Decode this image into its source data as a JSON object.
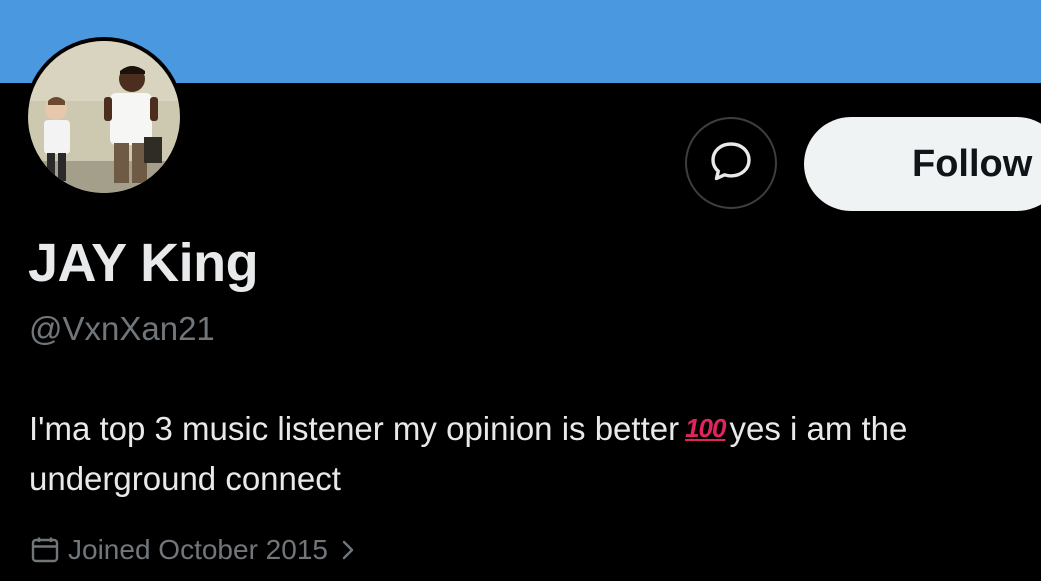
{
  "profile": {
    "display_name": "JAY King",
    "handle": "@VxnXan21",
    "bio_text": "I'ma top 3 music listener my opinion is better",
    "bio_emoji": "💯",
    "bio_text_2": "yes i am the underground connect",
    "joined": "Joined October 2015",
    "avatar_alt": "profile photo"
  },
  "actions": {
    "follow_label": "Follow",
    "message_icon": "message-bubble-icon"
  },
  "icons": {
    "calendar": "calendar-icon",
    "chevron": "chevron-right-icon"
  },
  "colors": {
    "banner": "#4a98e0",
    "background": "#000000",
    "primary_text": "#e7e9ea",
    "secondary_text": "#71767b",
    "follow_bg": "#eff3f4"
  }
}
